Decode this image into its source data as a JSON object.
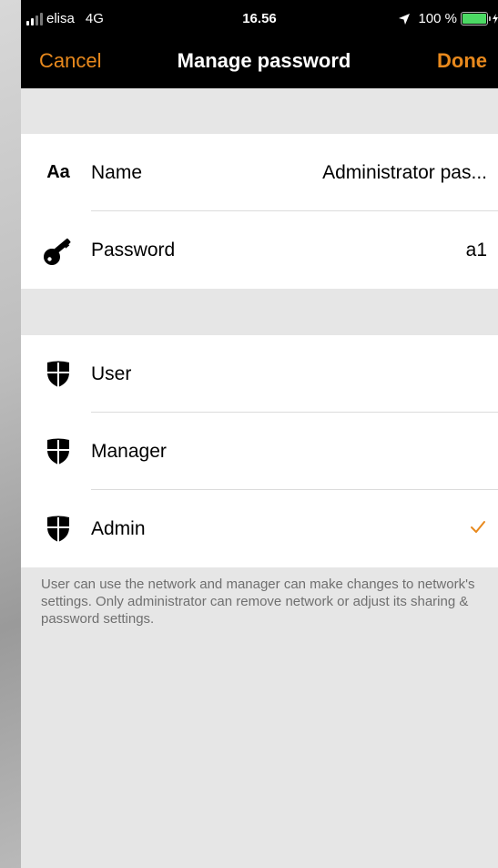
{
  "status_bar": {
    "carrier": "elisa",
    "network": "4G",
    "time": "16.56",
    "battery": "100 %",
    "signal_bars": 4,
    "signal_bars_active": 2,
    "battery_level": 1.0,
    "battery_color": "#4cd964"
  },
  "nav": {
    "cancel_label": "Cancel",
    "title": "Manage password",
    "done_label": "Done",
    "accent_color": "#e8891d"
  },
  "credentials": [
    {
      "icon": "text-format-icon",
      "icon_text": "Aa",
      "label": "Name",
      "value": "Administrator pas..."
    },
    {
      "icon": "key-icon",
      "label": "Password",
      "value": "a1"
    }
  ],
  "roles": [
    {
      "icon": "shield-icon",
      "label": "User",
      "selected": false
    },
    {
      "icon": "shield-icon",
      "label": "Manager",
      "selected": false
    },
    {
      "icon": "shield-icon",
      "label": "Admin",
      "selected": true
    }
  ],
  "footnote": "User can use the network and manager can make changes to network's settings. Only administrator can remove network or adjust its sharing & password settings."
}
